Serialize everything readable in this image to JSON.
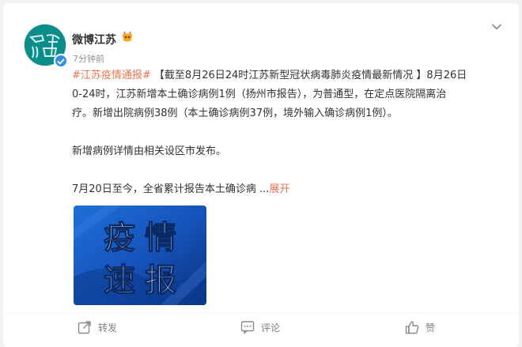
{
  "user": {
    "name": "微博江苏",
    "time": "7分钟前"
  },
  "post": {
    "hashtag": "#江苏疫情通报#",
    "line1_rest": " 【截至8月26日24时江苏新型冠状病毒肺炎疫情最新情况 】8月26日",
    "line2": "0-24时，江苏新增本土确诊病例1例（扬州市报告），为普通型，在定点医院隔离治",
    "line3": "疗。新增出院病例38例（本土确诊病例37例，境外输入确诊病例1例）。",
    "para2": "新增病例详情由相关设区市发布。",
    "para3": "7月20日至今，全省累计报告本土确诊病  ...",
    "expand_label": "展开"
  },
  "image": {
    "line1": [
      "疫",
      "情"
    ],
    "line2": [
      "速",
      "报"
    ]
  },
  "actions": {
    "repost_label": "转发",
    "comment_label": "评论",
    "like_label": "赞"
  },
  "colors": {
    "accent": "#eb7350",
    "verify_blue": "#2f8fe6",
    "avatar_teal": "#0d8c8c"
  }
}
